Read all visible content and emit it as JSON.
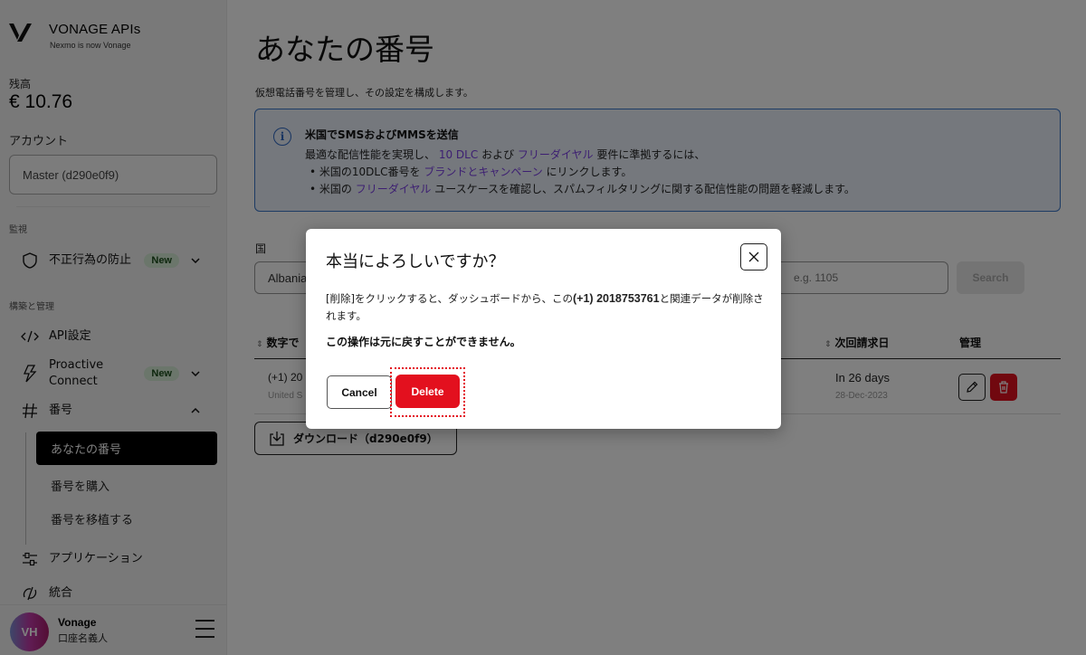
{
  "sidebar": {
    "brand_title": "VONAGE APIs",
    "brand_subtitle": "Nexmo is now Vonage",
    "balance_label": "残高",
    "balance_value": "€ 10.76",
    "account_label": "アカウント",
    "account_value": "Master (d290e0f9)",
    "sections": {
      "monitor": "監視",
      "build": "構築と管理"
    },
    "items": [
      {
        "label": "不正行為の防止",
        "badge": "New",
        "icon": "shield-icon",
        "expanded": false
      },
      {
        "label": "API設定",
        "icon": "code-icon"
      },
      {
        "label": "Proactive Connect",
        "badge": "New",
        "icon": "bolt-icon",
        "expanded": false
      },
      {
        "label": "番号",
        "icon": "hash-icon",
        "expanded": true
      },
      {
        "label": "アプリケーション",
        "icon": "sliders-icon"
      },
      {
        "label": "統合",
        "icon": "integration-icon"
      }
    ],
    "sub_items": [
      {
        "label": "あなたの番号",
        "active": true
      },
      {
        "label": "番号を購入",
        "active": false
      },
      {
        "label": "番号を移植する",
        "active": false
      }
    ],
    "user": {
      "initials": "VH",
      "name": "Vonage",
      "subtitle": "口座名義人"
    }
  },
  "main": {
    "title": "あなたの番号",
    "description": "仮想電話番号を管理し、その設定を構成します。",
    "info": {
      "title": "米国でSMSおよびMMSを送信",
      "line1_a": "最適な配信性能を実現し、",
      "line1_link1": "10 DLC",
      "line1_b": "および",
      "line1_link2": "フリーダイヤル",
      "line1_c": "要件に準拠するには、",
      "bullet1_a": "米国の10DLC番号を",
      "bullet1_link": "ブランドとキャンペーン",
      "bullet1_b": "にリンクします。",
      "bullet2_a": "米国の",
      "bullet2_link": "フリーダイヤル",
      "bullet2_b": "ユースケースを確認し、スパムフィルタリングに関する配信性能の問題を軽減します。"
    },
    "filters": {
      "country_label": "国",
      "country_value": "Albania",
      "number_placeholder": "e.g. 1105",
      "search_label": "Search"
    },
    "table": {
      "headers": [
        "数字で",
        "次回請求日",
        "管理"
      ],
      "rows": [
        {
          "number": "(+1) 20",
          "country": "United S",
          "next_billing": "In 26 days",
          "next_billing_date": "28-Dec-2023"
        }
      ]
    },
    "download_label": "ダウンロード（d290e0f9）"
  },
  "modal": {
    "title": "本当によろしいですか？",
    "body_a": "[削除]をクリックすると、ダッシュボードから、この",
    "body_number": "(+1) 2018753761",
    "body_b": "と関連データが削除されます。",
    "warning": "この操作は元に戻すことができません。",
    "cancel_label": "Cancel",
    "delete_label": "Delete"
  },
  "colors": {
    "accent_red": "#e3101e",
    "link_purple": "#7b3fe4",
    "info_blue": "#3b76c8",
    "badge_green": "#d6ecd6"
  }
}
